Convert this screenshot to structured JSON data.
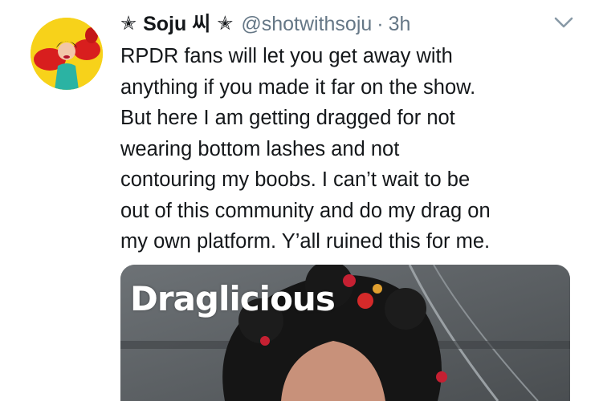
{
  "tweet": {
    "display_name": "Soju 씨",
    "name_decoration": "✭",
    "handle": "@shotwithsoju",
    "separator": "·",
    "timestamp": "3h",
    "text_lines": [
      "RPDR fans will let you get away with",
      "anything if you made it far on the show.",
      "But here I am getting dragged for not",
      "wearing bottom lashes and not",
      "contouring my boobs. I can’t wait to be",
      "out of this community and do my drag on",
      "my own platform. Y’all ruined this for me."
    ]
  },
  "media": {
    "logo_text": "Draglicious"
  },
  "icons": {
    "caret": "chevron-down-icon",
    "avatar": "avatar"
  },
  "colors": {
    "text_primary": "#14171a",
    "text_secondary": "#657786",
    "avatar_bg": "#f7d21a"
  }
}
